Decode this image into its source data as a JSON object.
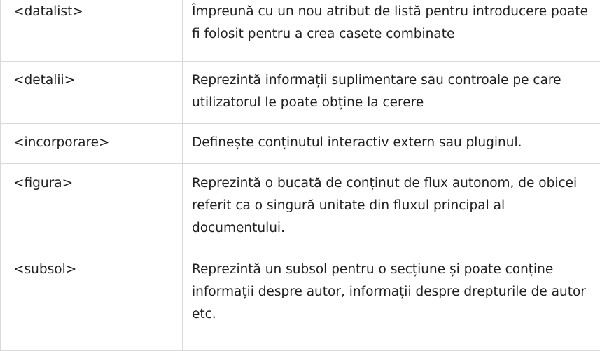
{
  "rows": [
    {
      "tag": "<datalist>",
      "description": "Împreună cu un nou atribut de listă pentru introducere poate fi folosit pentru a crea casete combinate"
    },
    {
      "tag": "<detalii>",
      "description": "Reprezintă informații suplimentare sau controale pe care utilizatorul le poate obține la cerere"
    },
    {
      "tag": "<incorporare>",
      "description": "Definește conținutul interactiv extern sau pluginul."
    },
    {
      "tag": "<figura>",
      "description": "Reprezintă o bucată de conținut de flux autonom, de obicei referit ca o singură unitate din fluxul principal al documentului."
    },
    {
      "tag": "<subsol>",
      "description": "Reprezintă un subsol pentru o secțiune și poate conține informații despre autor, informații despre drepturile de autor etc."
    }
  ]
}
